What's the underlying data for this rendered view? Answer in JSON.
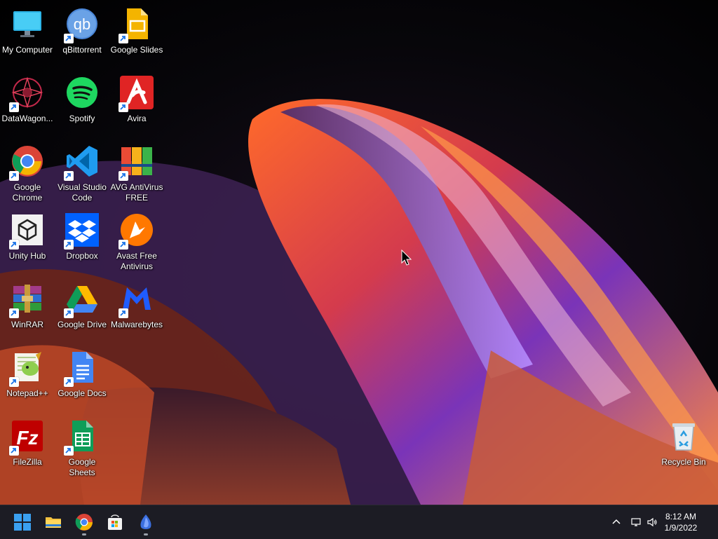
{
  "desktop": {
    "icons": [
      {
        "label": "My Computer",
        "icon": "monitor-icon"
      },
      {
        "label": "qBittorrent",
        "icon": "qbittorrent-icon"
      },
      {
        "label": "Google Slides",
        "icon": "google-slides-icon"
      },
      {
        "label": "DataWagon...",
        "icon": "datawagon-icon"
      },
      {
        "label": "Spotify",
        "icon": "spotify-icon"
      },
      {
        "label": "Avira",
        "icon": "avira-icon"
      },
      {
        "label": "Google Chrome",
        "icon": "chrome-icon"
      },
      {
        "label": "Visual Studio Code",
        "icon": "vscode-icon"
      },
      {
        "label": "AVG AntiVirus FREE",
        "icon": "avg-icon"
      },
      {
        "label": "Unity Hub",
        "icon": "unity-icon"
      },
      {
        "label": "Dropbox",
        "icon": "dropbox-icon"
      },
      {
        "label": "Avast Free Antivirus",
        "icon": "avast-icon"
      },
      {
        "label": "WinRAR",
        "icon": "winrar-icon"
      },
      {
        "label": "Google Drive",
        "icon": "google-drive-icon"
      },
      {
        "label": "Malwarebytes",
        "icon": "malwarebytes-icon"
      },
      {
        "label": "Notepad++",
        "icon": "notepadpp-icon"
      },
      {
        "label": "Google Docs",
        "icon": "google-docs-icon"
      },
      {
        "label": "FileZilla",
        "icon": "filezilla-icon"
      },
      {
        "label": "Google Sheets",
        "icon": "google-sheets-icon"
      },
      {
        "label": "Recycle Bin",
        "icon": "recycle-bin-icon"
      }
    ]
  },
  "taskbar": {
    "items": [
      {
        "name": "start-button",
        "icon": "windows-logo-icon"
      },
      {
        "name": "file-explorer",
        "icon": "folder-icon"
      },
      {
        "name": "chrome",
        "icon": "chrome-icon"
      },
      {
        "name": "microsoft-store",
        "icon": "store-icon"
      },
      {
        "name": "app-running",
        "icon": "blue-app-icon"
      }
    ],
    "tray": {
      "chevron": "chevron-up-icon",
      "network": "network-icon",
      "volume": "speaker-icon"
    },
    "clock": {
      "time": "8:12 AM",
      "date": "1/9/2022"
    }
  },
  "colors": {
    "taskbar": "#1c1c24",
    "accent": "#0078d4"
  }
}
